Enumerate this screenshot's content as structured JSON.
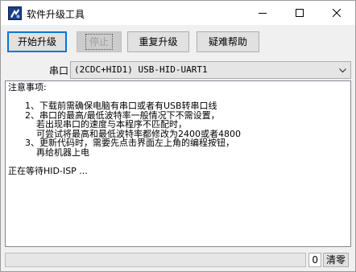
{
  "window": {
    "title": "软件升级工具"
  },
  "toolbar": {
    "start_label": "开始升级",
    "stop_label": "停止",
    "retry_label": "重复升级",
    "help_label": "疑难帮助"
  },
  "port": {
    "label": "串口",
    "selected": "(2CDC+HID1) USB-HID-UART1"
  },
  "log": {
    "text": "注意事项:\n\n      1、下载前需确保电脑有串口或者有USB转串口线\n      2、串口的最高/最低波特率一般情况下不需设置，\n          若出现串口的速度与本程序不匹配时，\n          可尝试将最高和最低波特率都修改为2400或者4800\n      3、更新代码时，需要先点击界面左上角的编程按钮，\n          再给机器上电\n\n正在等待HID-ISP ..."
  },
  "status": {
    "progress": 0,
    "count": "0",
    "clear_label": "清零"
  },
  "colors": {
    "accent": "#0078d7",
    "progress_fill": "#06b025"
  }
}
